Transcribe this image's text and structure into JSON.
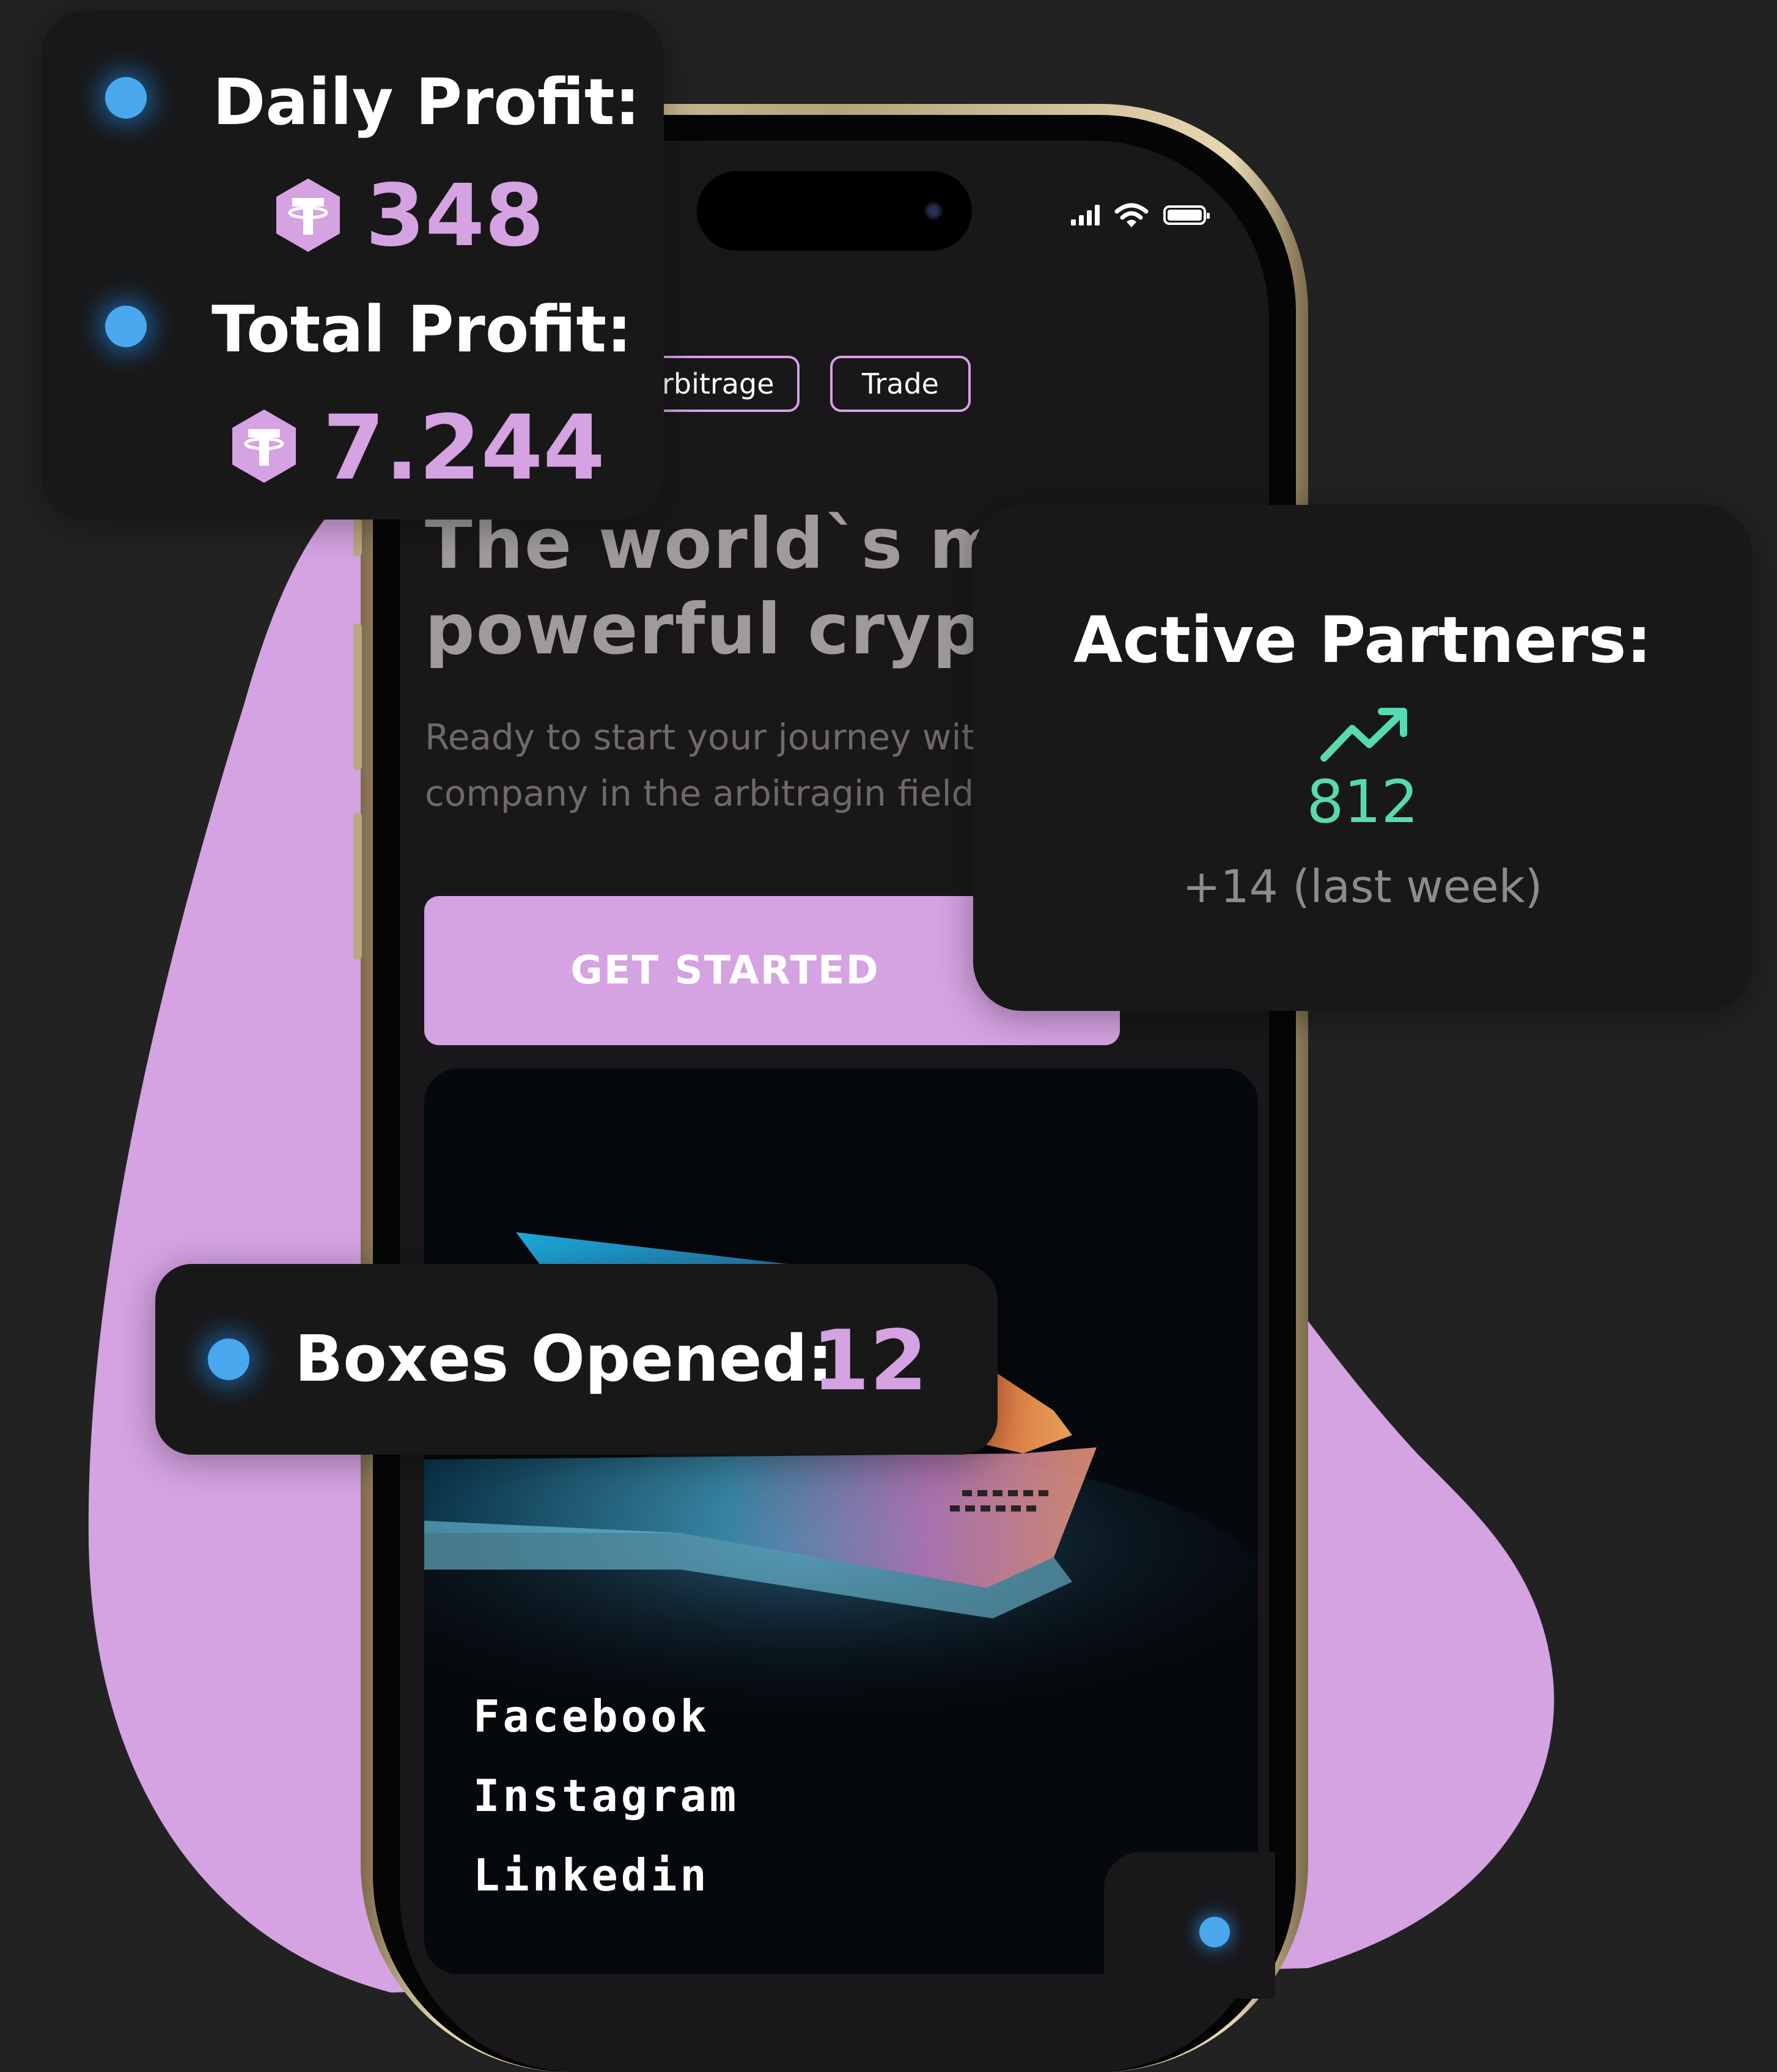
{
  "colors": {
    "background": "#222222",
    "accent_purple": "#d5a2e2",
    "card": "#181818",
    "glow_blue": "#4aa8ef",
    "trend_green": "#57d9b1"
  },
  "status_bar": {
    "icons": [
      "signal-icon",
      "wifi-icon",
      "battery-icon"
    ]
  },
  "nav": {
    "chips": [
      {
        "label": "Arbitrage"
      },
      {
        "label": "Trade"
      }
    ]
  },
  "hero": {
    "title_line1": "The world`s most",
    "title_line2": "powerful crypto",
    "subtitle_line1": "Ready to start your journey with the best",
    "subtitle_line2": "company in the arbitragin field?",
    "cta_label": "GET STARTED"
  },
  "social": {
    "links": [
      "Facebook",
      "Instagram",
      "Linkedin"
    ]
  },
  "profit_card": {
    "daily_label": "Daily Profit:",
    "daily_value": "348",
    "total_label": "Total Profit:",
    "total_value": "7.244",
    "currency_icon": "tether-icon"
  },
  "active_card": {
    "label": "Active Partners:",
    "trend_icon": "trending-up-icon",
    "value": "812",
    "delta": "+14 (last week)"
  },
  "boxes_card": {
    "label": "Boxes Opened:",
    "value": "12"
  }
}
